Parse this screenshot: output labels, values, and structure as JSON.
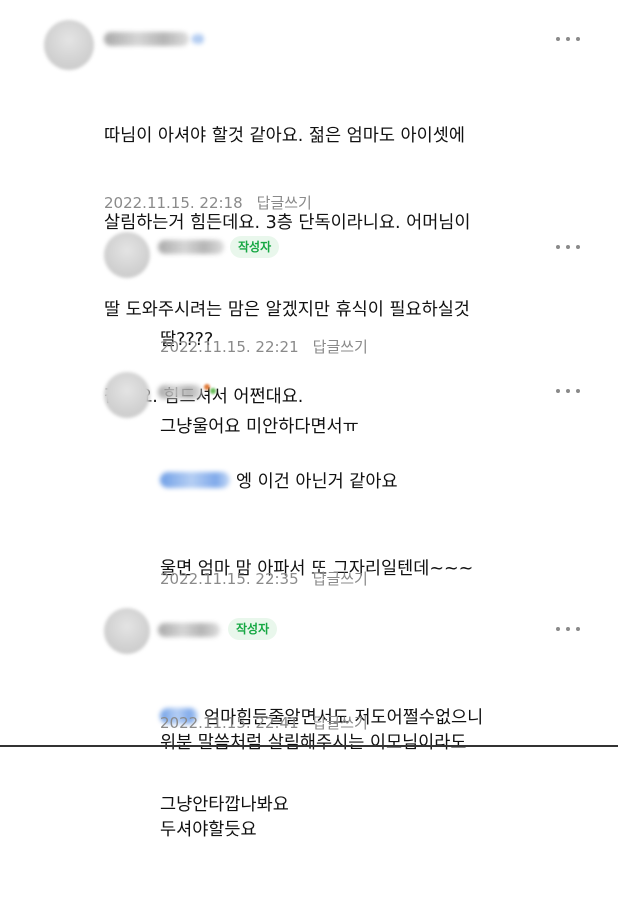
{
  "comments": [
    {
      "author_is_writer": false,
      "lines": [
        "따님이 아셔야 할것 같아요. 젊은 엄마도 아이셋에",
        "살림하는거 힘든데요. 3층 단독이라니요. 어머님이",
        "딸 도와주시려는 맘은 알겠지만 휴식이 필요하실것",
        "같아요. 힘드셔서 어쩐대요."
      ],
      "timestamp": "2022.11.15. 22:18",
      "reply_label": "답글쓰기"
    },
    {
      "author_is_writer": true,
      "badge": "작성자",
      "lines": [
        "딸????",
        "그냥울어요 미안하다면서ㅠ"
      ],
      "timestamp": "2022.11.15. 22:21",
      "reply_label": "답글쓰기"
    },
    {
      "author_is_writer": false,
      "lines": [
        "엥 이건 아닌거 같아요",
        "울면 엄마 맘 아파서 또 그자리일텐데~~~",
        "",
        "위분 말씀처럼 살림해주시는 이모님이라도",
        "두셔야할듯요"
      ],
      "timestamp": "2022.11.15. 22:35",
      "reply_label": "답글쓰기"
    },
    {
      "author_is_writer": true,
      "badge": "작성자",
      "lines": [
        "엄마힘든줄알면서도 저도어쩔수없으니",
        "그냥안타깝나봐요"
      ],
      "timestamp": "2022.11.15. 22:41",
      "reply_label": "답글쓰기"
    }
  ],
  "icons": {
    "more": "more-options-icon",
    "avatar": "default-avatar"
  },
  "colors": {
    "badge_text": "#17a844",
    "badge_bg": "#e9f7ec",
    "meta_text": "#8a8a8a",
    "mention_blue": "#6f9fe6"
  }
}
